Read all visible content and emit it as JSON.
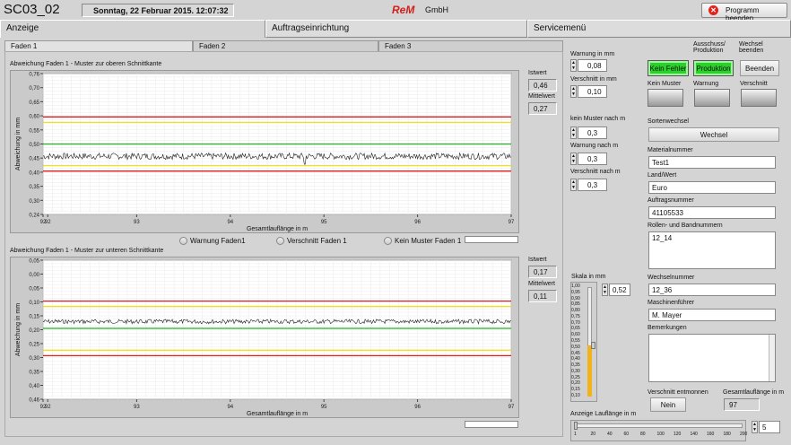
{
  "app_title": "SC03_02",
  "datetime": "Sonntag, 22 Februar 2015.  12:07:32",
  "logo": "ReM",
  "logo_suffix": "GmbH",
  "exit_button": "Programm beenden",
  "main_tabs": [
    "Anzeige",
    "Auftragseinrichtung",
    "Servicemenü"
  ],
  "sub_tabs": [
    "Faden 1",
    "Faden 2",
    "Faden 3"
  ],
  "chart_top": {
    "title": "Abweichung Faden 1 - Muster zur oberen Schnittkante",
    "xlabel": "Gesamtlauflänge in m",
    "ylabel": "Abweichung in mm",
    "istwert_label": "Istwert",
    "istwert": "0,46",
    "mittelwert_label": "Mittelwert",
    "mittelwert": "0,27"
  },
  "chart_bottom": {
    "title": "Abweichung Faden 1 - Muster zur unteren Schnittkante",
    "xlabel": "Gesamtlauflänge in m",
    "ylabel": "Abweichung in mm",
    "istwert_label": "Istwert",
    "istwert": "0,17",
    "mittelwert_label": "Mittelwert",
    "mittelwert": "0,11"
  },
  "legend": [
    "Warnung Faden1",
    "Verschnitt Faden 1",
    "Kein Muster Faden 1"
  ],
  "chart_data": [
    {
      "type": "line",
      "title": "Abweichung Faden 1 - Muster zur oberen Schnittkante",
      "xlabel": "Gesamtlauflänge in m",
      "ylabel": "Abweichung in mm",
      "xlim": [
        92,
        97
      ],
      "ylim": [
        0.24,
        0.76
      ],
      "x_ticks": [
        "92",
        "92",
        "93",
        "94",
        "95",
        "96",
        "97"
      ],
      "y_ticks": [
        "0,76",
        "0,70",
        "0,65",
        "0,60",
        "0,55",
        "0,50",
        "0,45",
        "0,40",
        "0,35",
        "0,30",
        "0,24"
      ],
      "reference_lines": [
        {
          "value": 0.6,
          "color": "#e02020"
        },
        {
          "value": 0.58,
          "color": "#f0e020"
        },
        {
          "value": 0.5,
          "color": "#20b020"
        },
        {
          "value": 0.42,
          "color": "#f0e020"
        },
        {
          "value": 0.4,
          "color": "#e02020"
        }
      ],
      "series": [
        {
          "mean": 0.455,
          "noise": 0.012,
          "color": "#222222",
          "dip_at": 94.8,
          "dip_value": 0.425
        }
      ],
      "grid": true
    },
    {
      "type": "line",
      "title": "Abweichung Faden 1 - Muster zur unteren Schnittkante",
      "xlabel": "Gesamtlauflänge in m",
      "ylabel": "Abweichung in mm",
      "xlim": [
        92,
        97
      ],
      "ylim": [
        -0.05,
        0.46
      ],
      "x_ticks": [
        "92",
        "92",
        "93",
        "94",
        "95",
        "96",
        "97"
      ],
      "y_ticks": [
        "0,05",
        "0,00",
        "0,05",
        "0,10",
        "0,15",
        "0,20",
        "0,25",
        "0,30",
        "0,35",
        "0,40",
        "0,46"
      ],
      "inverted": true,
      "reference_lines": [
        {
          "value": 0.1,
          "color": "#e02020"
        },
        {
          "value": 0.12,
          "color": "#f0e020"
        },
        {
          "value": 0.2,
          "color": "#20b020"
        },
        {
          "value": 0.28,
          "color": "#f0e020"
        },
        {
          "value": 0.3,
          "color": "#e02020"
        }
      ],
      "series": [
        {
          "mean": 0.175,
          "noise": 0.008,
          "color": "#222222"
        }
      ],
      "grid": true
    }
  ],
  "settings": {
    "warnung_label": "Warnung in mm",
    "warnung_value": "0,08",
    "verschnitt_label": "Verschnitt in mm",
    "verschnitt_value": "0,10",
    "kein_muster_label": "kein Muster nach m",
    "kein_muster_value": "0,3",
    "warnung_nach_label": "Warnung nach m",
    "warnung_nach_value": "0,3",
    "verschnitt_nach_label": "Verschnitt nach m",
    "verschnitt_nach_value": "0,3",
    "skala_label": "Skala in mm",
    "skala_value": "0,52",
    "skala_ticks": [
      "1,00",
      "0,95",
      "0,90",
      "0,85",
      "0,80",
      "0,75",
      "0,70",
      "0,65",
      "0,60",
      "0,55",
      "0,50",
      "0,45",
      "0,40",
      "0,35",
      "0,30",
      "0,25",
      "0,20",
      "0,15",
      "0,10"
    ],
    "laufl_label": "Anzeige Lauflänge in m",
    "laufl_ticks": [
      "1",
      "20",
      "40",
      "60",
      "80",
      "100",
      "120",
      "140",
      "160",
      "180",
      "200"
    ],
    "laufl_value": "5"
  },
  "status": {
    "ausschuss_label": "Ausschuss/ Produktion",
    "wechsel_beenden_label": "Wechsel beenden",
    "kein_fehler_btn": "Kein Fehler",
    "produktion_btn": "Produktion",
    "beenden_btn": "Beenden",
    "kein_muster_label": "Kein Muster",
    "warnung_label": "Warnung",
    "verschnitt_label": "Verschnitt"
  },
  "order": {
    "sortenwechsel_label": "Sortenwechsel",
    "wechsel_btn": "Wechsel",
    "materialnummer_label": "Materialnummer",
    "materialnummer": "Test1",
    "land_label": "Land/Wert",
    "land": "Euro",
    "auftragsnummer_label": "Auftragsnummer",
    "auftragsnummer": "41105533",
    "rollen_label": "Rollen- und Bandnummern",
    "rollen": "12_14",
    "wechselnummer_label": "Wechselnummer",
    "wechselnummer": "12_36",
    "maschinenfuehrer_label": "Maschinenführer",
    "maschinenfuehrer": "M. Mayer",
    "bemerkungen_label": "Bemerkungen",
    "verschnitt_entmonnen_label": "Verschnitt entmonnen",
    "nein_btn": "Nein",
    "gesamtlaufl_label": "Gesamtlauflänge in m",
    "gesamtlaufl": "97"
  }
}
